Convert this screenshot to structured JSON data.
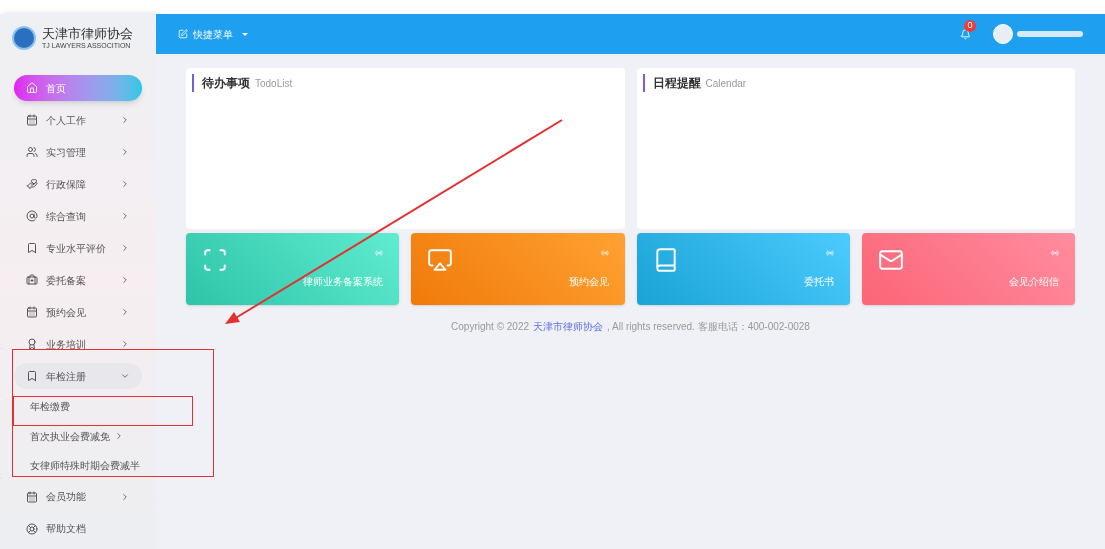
{
  "logo": {
    "title": "天津市律师协会",
    "subtitle": "TJ LAWYERS ASSOCITION"
  },
  "sidebar": {
    "items": [
      {
        "label": "首页",
        "selected": true,
        "expanded": false,
        "has_arrow": false
      },
      {
        "label": "个人工作",
        "selected": false,
        "expanded": false,
        "has_arrow": true
      },
      {
        "label": "实习管理",
        "selected": false,
        "expanded": false,
        "has_arrow": true
      },
      {
        "label": "行政保障",
        "selected": false,
        "expanded": false,
        "has_arrow": true
      },
      {
        "label": "综合查询",
        "selected": false,
        "expanded": false,
        "has_arrow": true
      },
      {
        "label": "专业水平评价",
        "selected": false,
        "expanded": false,
        "has_arrow": true
      },
      {
        "label": "委托备案",
        "selected": false,
        "expanded": false,
        "has_arrow": true
      },
      {
        "label": "预约会见",
        "selected": false,
        "expanded": false,
        "has_arrow": true
      },
      {
        "label": "业务培训",
        "selected": false,
        "expanded": false,
        "has_arrow": true
      },
      {
        "label": "年检注册",
        "selected": false,
        "expanded": true,
        "has_arrow": true,
        "children": [
          {
            "label": "年检缴费",
            "has_arrow": false
          },
          {
            "label": "首次执业会费减免",
            "has_arrow": true
          },
          {
            "label": "女律师特殊时期会费减半",
            "has_arrow": false
          }
        ]
      },
      {
        "label": "会员功能",
        "selected": false,
        "expanded": false,
        "has_arrow": true
      },
      {
        "label": "帮助文档",
        "selected": false,
        "expanded": false,
        "has_arrow": false
      }
    ]
  },
  "header": {
    "quick_menu": "快捷菜单",
    "notification_count": "0"
  },
  "panels": [
    {
      "title": "待办事项",
      "subtitle": "TodoList"
    },
    {
      "title": "日程提醒",
      "subtitle": "Calendar"
    }
  ],
  "tiles": [
    {
      "label": "律师业务备案系统",
      "color": "#2ec4a8"
    },
    {
      "label": "预约会见",
      "color": "#f07a0a"
    },
    {
      "label": "委托书",
      "color": "#1aa3d6"
    },
    {
      "label": "会见介绍信",
      "color": "#fb6577"
    }
  ],
  "footer": {
    "prefix": "Copyright © 2022",
    "link": "天津市律师协会",
    "suffix": ", All rights reserved. 客服电话：400-002-0028"
  }
}
